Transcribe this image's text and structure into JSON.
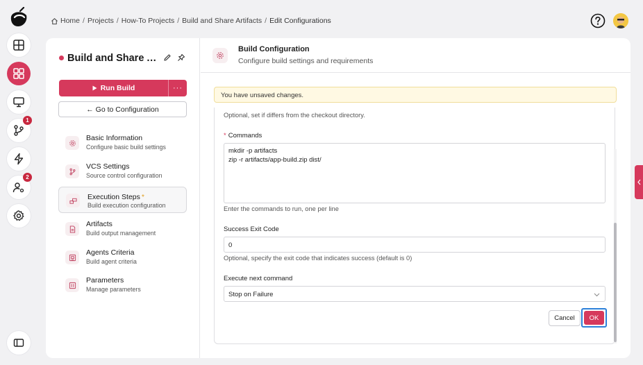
{
  "breadcrumb": {
    "items": [
      "Home",
      "Projects",
      "How-To Projects",
      "Build and Share Artifacts",
      "Edit Configurations"
    ],
    "separator": "/"
  },
  "rail": {
    "badges": {
      "vcs": "1",
      "users": "2"
    }
  },
  "project": {
    "title": "Build and Share Artifacts"
  },
  "actions": {
    "run_build": "Run Build",
    "more": "···",
    "goto_config": "← Go to Configuration"
  },
  "nav": {
    "items": [
      {
        "title": "Basic Information",
        "subtitle": "Configure basic build settings"
      },
      {
        "title": "VCS Settings",
        "subtitle": "Source control configuration"
      },
      {
        "title": "Execution Steps",
        "subtitle": "Build execution configuration",
        "required_marker": "*"
      },
      {
        "title": "Artifacts",
        "subtitle": "Build output management"
      },
      {
        "title": "Agents Criteria",
        "subtitle": "Build agent criteria"
      },
      {
        "title": "Parameters",
        "subtitle": "Manage parameters"
      }
    ]
  },
  "section": {
    "title": "Build Configuration",
    "subtitle": "Configure build settings and requirements"
  },
  "alert": {
    "unsaved": "You have unsaved changes."
  },
  "form": {
    "working_dir_hint": "Optional, set if differs from the checkout directory.",
    "commands": {
      "label": "Commands",
      "required_marker": "*",
      "lines": [
        "mkdir -p artifacts",
        "zip -r artifacts/app-build.zip dist/"
      ],
      "hint": "Enter the commands to run, one per line"
    },
    "exit_code": {
      "label": "Success Exit Code",
      "value": "0",
      "hint": "Optional, specify the exit code that indicates success (default is 0)"
    },
    "next_command": {
      "label": "Execute next command",
      "value": "Stop on Failure"
    },
    "cancel": "Cancel",
    "ok": "OK"
  },
  "colors": {
    "accent": "#d6395c",
    "alert_bg": "#fff9e3",
    "focus_ring": "#2b7fd9"
  }
}
